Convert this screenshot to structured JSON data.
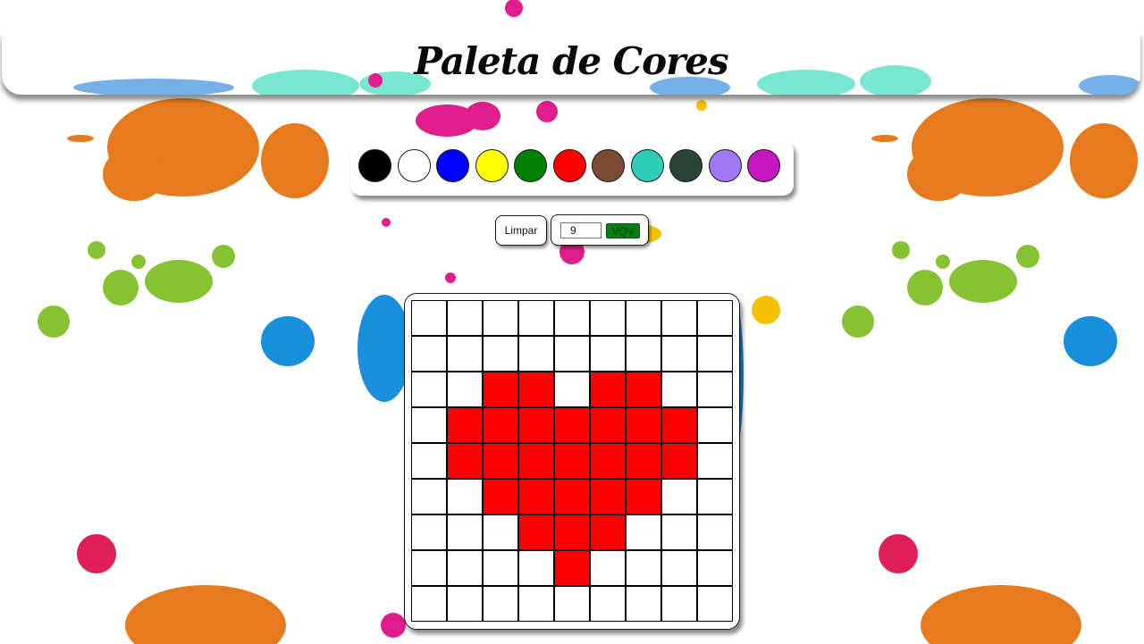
{
  "header": {
    "title": "Paleta de Cores"
  },
  "palette": {
    "colors": [
      {
        "name": "black",
        "hex": "#000000"
      },
      {
        "name": "white",
        "hex": "#ffffff"
      },
      {
        "name": "blue",
        "hex": "#0000ff"
      },
      {
        "name": "yellow",
        "hex": "#ffff00"
      },
      {
        "name": "green",
        "hex": "#008000"
      },
      {
        "name": "red",
        "hex": "#ff0000"
      },
      {
        "name": "brown",
        "hex": "#7b4a34"
      },
      {
        "name": "turquoise",
        "hex": "#2ecdb8"
      },
      {
        "name": "dark-green",
        "hex": "#2a4436"
      },
      {
        "name": "lavender",
        "hex": "#a077f5"
      },
      {
        "name": "magenta",
        "hex": "#c516c0"
      }
    ]
  },
  "controls": {
    "clear_label": "Limpar",
    "board_size_value": "9",
    "generate_label": "VQV"
  },
  "board": {
    "size": 9,
    "filled_color": "#ff0000",
    "empty_color": "#ffffff",
    "filled_cells": [
      [
        2,
        2
      ],
      [
        2,
        3
      ],
      [
        2,
        5
      ],
      [
        2,
        6
      ],
      [
        3,
        1
      ],
      [
        3,
        2
      ],
      [
        3,
        3
      ],
      [
        3,
        4
      ],
      [
        3,
        5
      ],
      [
        3,
        6
      ],
      [
        3,
        7
      ],
      [
        4,
        1
      ],
      [
        4,
        2
      ],
      [
        4,
        3
      ],
      [
        4,
        4
      ],
      [
        4,
        5
      ],
      [
        4,
        6
      ],
      [
        4,
        7
      ],
      [
        5,
        2
      ],
      [
        5,
        3
      ],
      [
        5,
        4
      ],
      [
        5,
        5
      ],
      [
        5,
        6
      ],
      [
        6,
        3
      ],
      [
        6,
        4
      ],
      [
        6,
        5
      ],
      [
        7,
        4
      ]
    ]
  }
}
